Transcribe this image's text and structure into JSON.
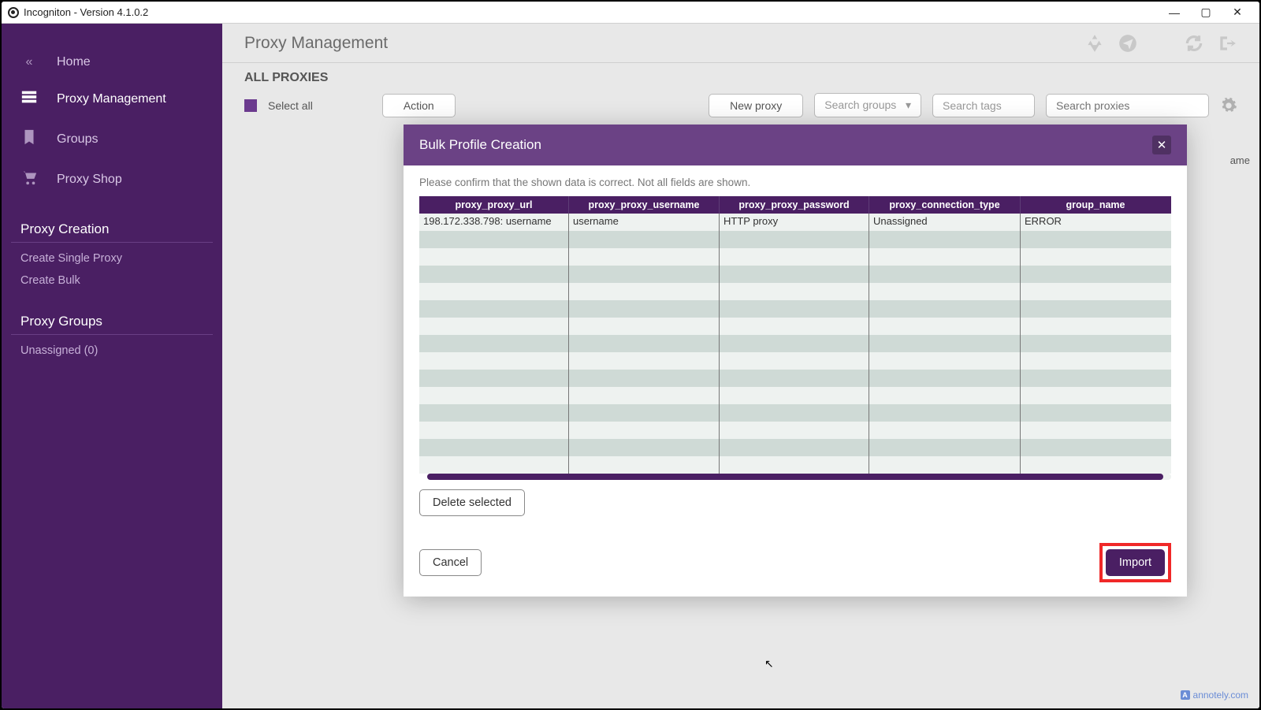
{
  "window": {
    "title": "Incogniton - Version 4.1.0.2"
  },
  "sidebar": {
    "items": [
      {
        "icon": "«",
        "label": "Home"
      },
      {
        "icon": "≡",
        "label": "Proxy Management"
      },
      {
        "icon": "🔖",
        "label": "Groups"
      },
      {
        "icon": "🛒",
        "label": "Proxy Shop"
      }
    ],
    "sec1_title": "Proxy Creation",
    "sec1_items": [
      "Create Single Proxy",
      "Create Bulk"
    ],
    "sec2_title": "Proxy Groups",
    "sec2_items": [
      "Unassigned (0)"
    ]
  },
  "main": {
    "heading": "Proxy Management",
    "section": "ALL PROXIES",
    "select_all": "Select all",
    "action_btn": "Action",
    "new_proxy_btn": "New proxy",
    "search_groups": "Search groups",
    "search_tags": "Search tags",
    "search_proxies_ph": "Search proxies",
    "partial_col": "ame"
  },
  "modal": {
    "title": "Bulk Profile Creation",
    "note": "Please confirm that the shown data is correct. Not all fields are shown.",
    "headers": [
      "proxy_proxy_url",
      "proxy_proxy_username",
      "proxy_proxy_password",
      "proxy_connection_type",
      "group_name"
    ],
    "rows": [
      [
        "198.172.338.798: username",
        "username",
        "HTTP proxy",
        "Unassigned",
        "ERROR"
      ]
    ],
    "delete_btn": "Delete selected",
    "cancel_btn": "Cancel",
    "import_btn": "Import"
  },
  "watermark": "annotely.com"
}
